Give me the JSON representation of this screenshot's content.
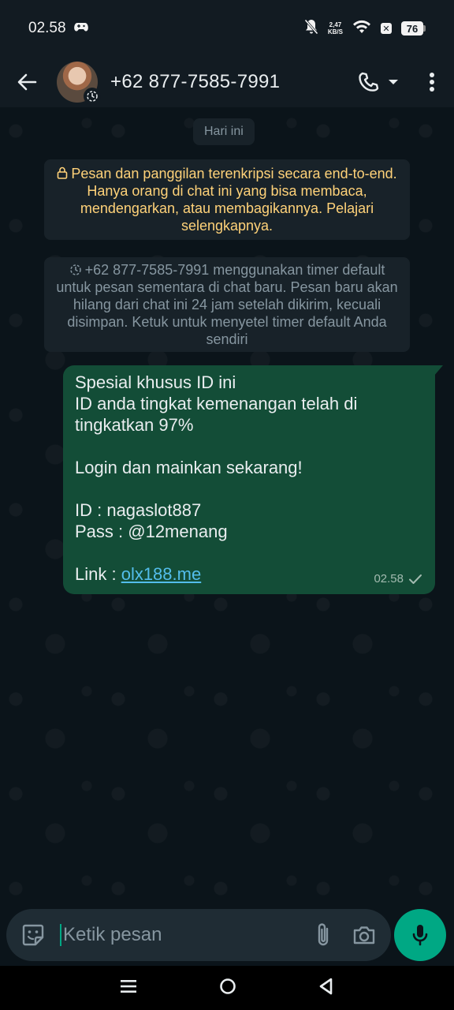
{
  "status_bar": {
    "time": "02.58",
    "net_speed_value": "2,47",
    "net_speed_unit": "KB/S",
    "battery_level": "76"
  },
  "header": {
    "contact_name": "+62 877-7585-7991"
  },
  "chat": {
    "date_chip": "Hari ini",
    "encryption_notice": "Pesan dan panggilan terenkripsi secara end-to-end. Hanya orang di chat ini yang bisa membaca, mendengarkan, atau membagikannya. Pelajari selengkapnya.",
    "timer_notice": "+62 877-7585-7991 menggunakan timer default untuk pesan sementara di chat baru. Pesan baru akan hilang dari chat ini 24 jam setelah dikirim, kecuali disimpan. Ketuk untuk menyetel timer default Anda sendiri",
    "message": {
      "line1": "Spesial khusus ID ini",
      "line2": "ID anda tingkat kemenangan telah di tingkatkan 97%",
      "line3": "Login dan mainkan sekarang!",
      "line4": "ID : nagaslot887",
      "line5": "Pass : @12menang",
      "link_label": "Link : ",
      "link_text": "olx188.me",
      "time": "02.58"
    }
  },
  "input": {
    "placeholder": "Ketik pesan"
  },
  "colors": {
    "background": "#0b141a",
    "bubble_out": "#134d37",
    "accent": "#00a884",
    "notice_yellow": "#ffd279",
    "link": "#53bdeb"
  }
}
